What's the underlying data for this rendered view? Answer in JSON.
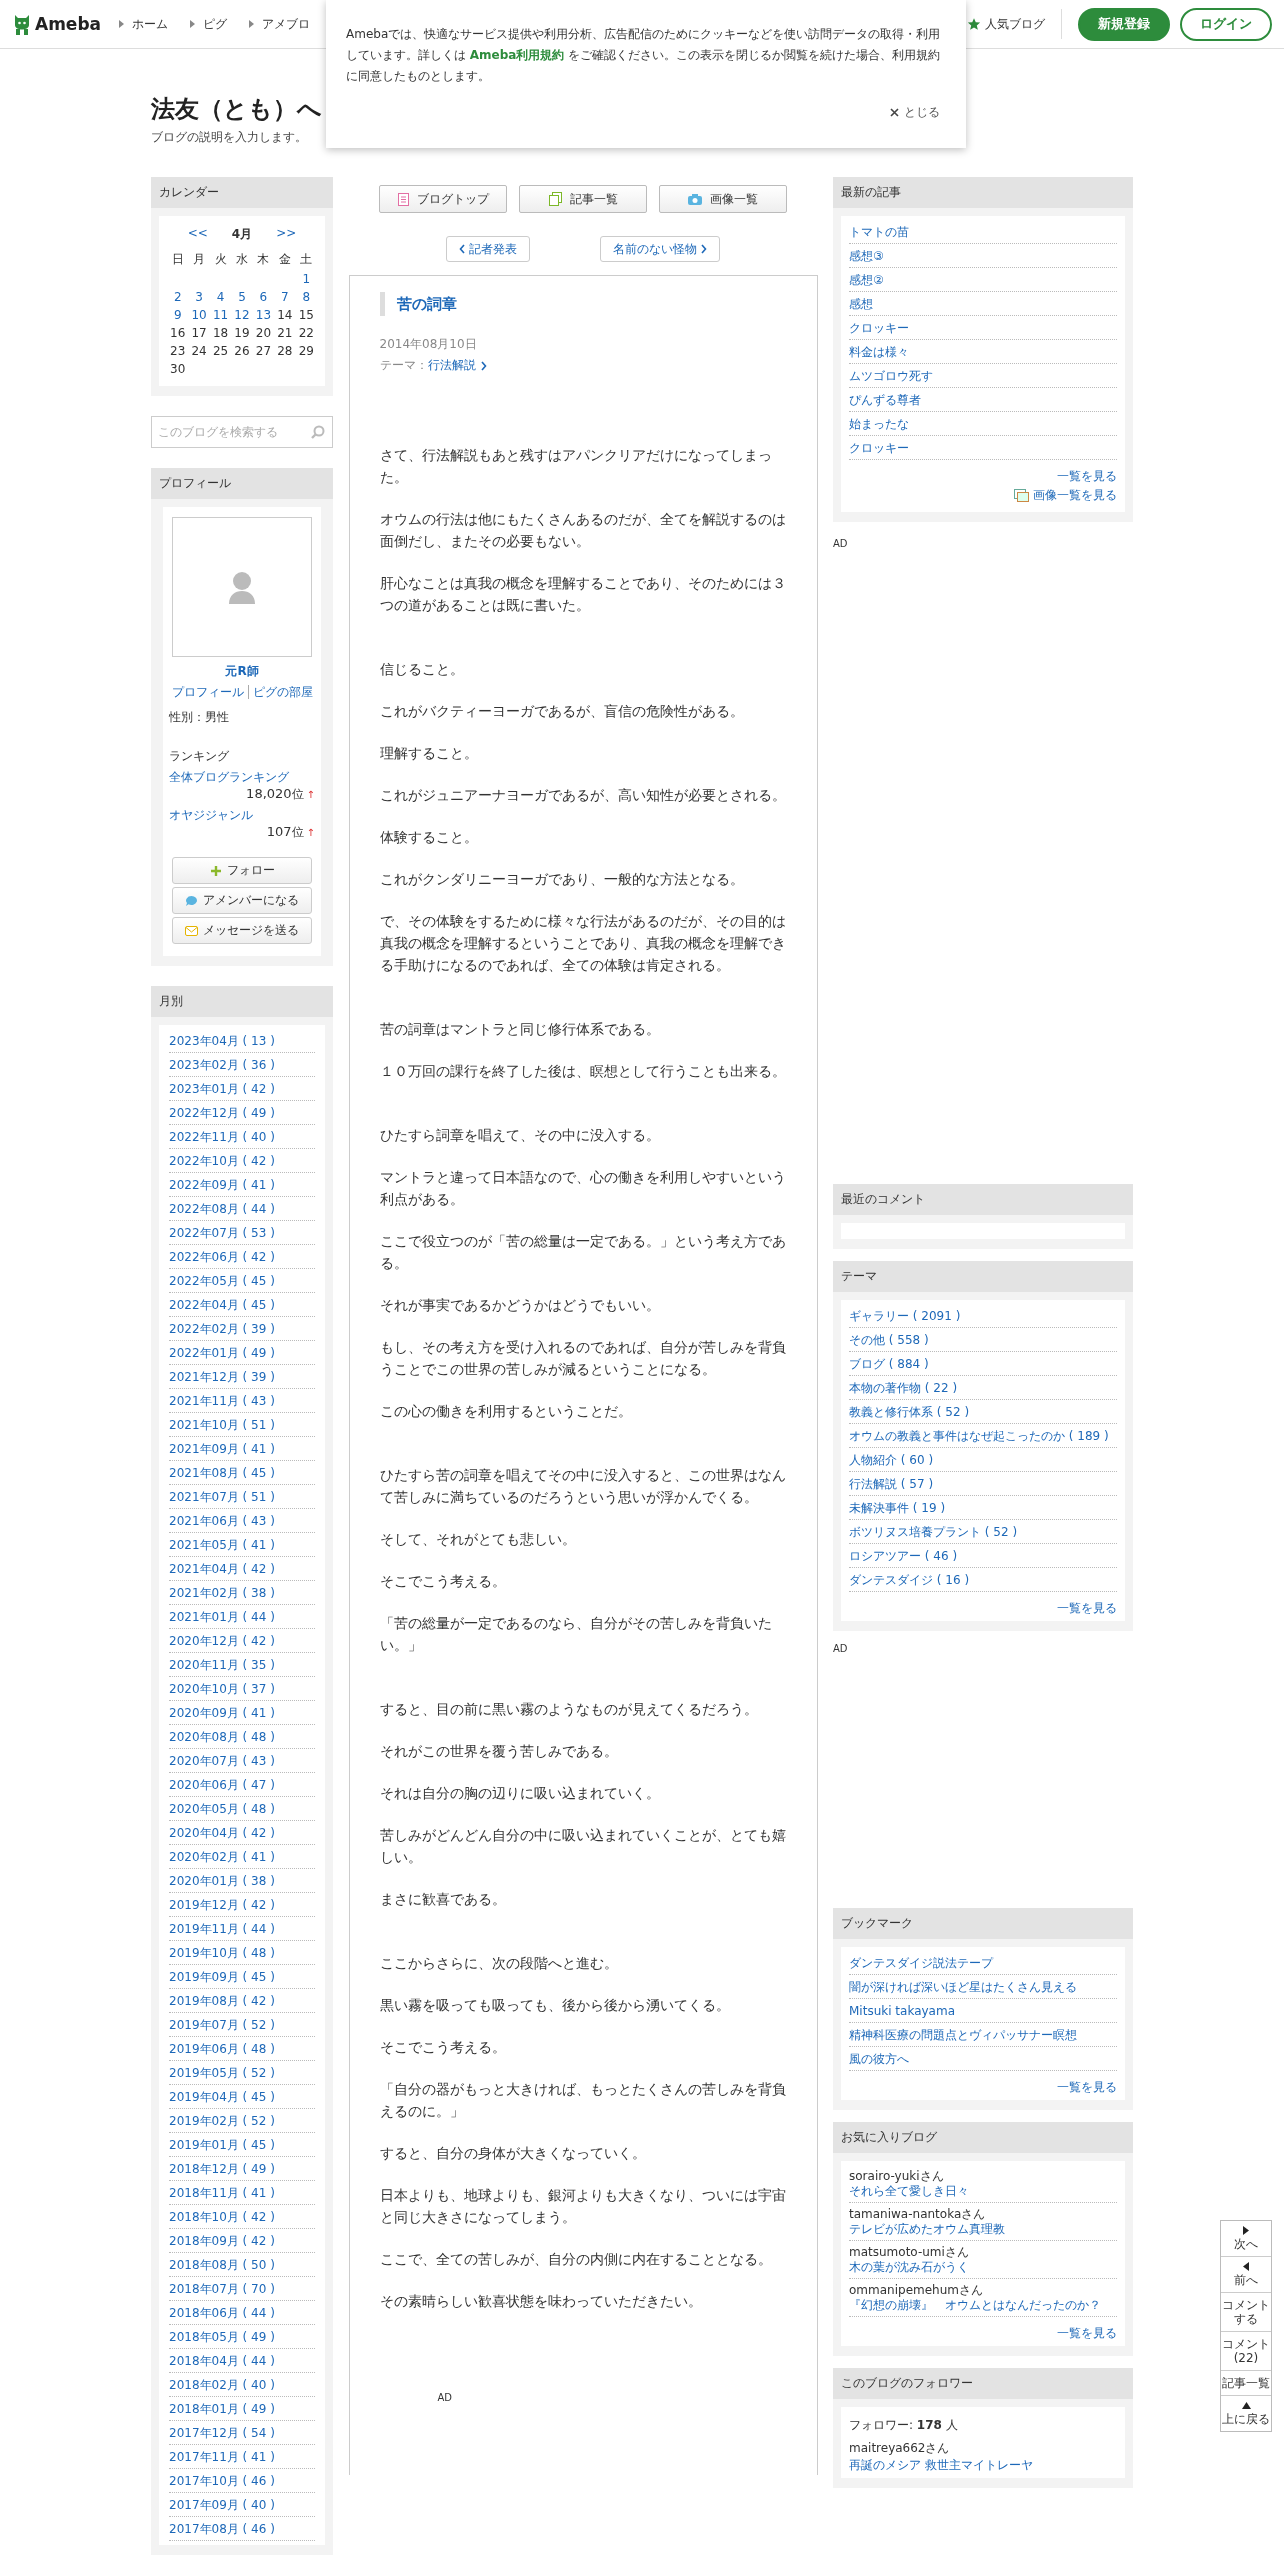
{
  "header": {
    "logo": "Ameba",
    "nav": [
      "ホーム",
      "ピグ",
      "アメブロ"
    ],
    "popular": "人気ブログ",
    "signup": "新規登録",
    "login": "ログイン"
  },
  "cookie_banner": {
    "text": "Amebaでは、快適なサービス提供や利用分析、広告配信のためにクッキーなどを使い訪問データの取得・利用しています。詳しくは",
    "link": "Ameba利用規約",
    "text_after": "をご確認ください。この表示を閉じるか閲覧を続けた場合、利用規約に同意したものとします。",
    "close": "とじる"
  },
  "blog": {
    "title": "法友（とも）へ",
    "description": "ブログの説明を入力します。"
  },
  "calendar": {
    "heading": "カレンダー",
    "prev": "<<",
    "month": "4月",
    "next": ">>",
    "weekdays": [
      "日",
      "月",
      "火",
      "水",
      "木",
      "金",
      "土"
    ],
    "weeks": [
      {
        "days": [
          {
            "day": "1",
            "has_posts": true
          }
        ]
      },
      {
        "days": [
          {
            "day": "2",
            "has_posts": true
          },
          {
            "day": "3",
            "has_posts": true
          },
          {
            "day": "4",
            "has_posts": true
          },
          {
            "day": "5",
            "has_posts": true
          },
          {
            "day": "6",
            "has_posts": true
          },
          {
            "day": "7",
            "has_posts": true
          },
          {
            "day": "8",
            "has_posts": true
          }
        ]
      },
      {
        "days": [
          {
            "day": "9",
            "has_posts": true
          },
          {
            "day": "10",
            "has_posts": true
          },
          {
            "day": "11",
            "has_posts": true
          },
          {
            "day": "12",
            "has_posts": true
          },
          {
            "day": "13",
            "has_posts": true
          },
          {
            "day": "14",
            "has_posts": false
          },
          {
            "day": "15",
            "has_posts": false
          }
        ]
      },
      {
        "days": [
          {
            "day": "16",
            "has_posts": false
          },
          {
            "day": "17",
            "has_posts": false
          },
          {
            "day": "18",
            "has_posts": false
          },
          {
            "day": "19",
            "has_posts": false
          },
          {
            "day": "20",
            "has_posts": false
          },
          {
            "day": "21",
            "has_posts": false
          },
          {
            "day": "22",
            "has_posts": false
          }
        ]
      },
      {
        "days": [
          {
            "day": "23",
            "has_posts": false
          },
          {
            "day": "24",
            "has_posts": false
          },
          {
            "day": "25",
            "has_posts": false
          },
          {
            "day": "26",
            "has_posts": false
          },
          {
            "day": "27",
            "has_posts": false
          },
          {
            "day": "28",
            "has_posts": false
          },
          {
            "day": "29",
            "has_posts": false
          }
        ]
      },
      {
        "days": [
          {
            "day": "30",
            "has_posts": false
          }
        ]
      }
    ]
  },
  "search": {
    "placeholder": "このブログを検索する"
  },
  "profile": {
    "heading": "プロフィール",
    "name": "元R師",
    "links": [
      "プロフィール",
      "ピグの部屋"
    ],
    "gender": "性別：男性",
    "ranking_heading": "ランキング",
    "rankings": [
      {
        "label": "全体ブログランキング",
        "rank": "18,020",
        "unit": "位",
        "arrow": "↑"
      },
      {
        "label": "オヤジジャンル",
        "rank": "107",
        "unit": "位",
        "arrow": "↑"
      }
    ],
    "buttons": [
      {
        "kind": "follow",
        "label": "フォロー"
      },
      {
        "kind": "amember",
        "label": "アメンバーになる"
      },
      {
        "kind": "message",
        "label": "メッセージを送る"
      }
    ]
  },
  "archive": {
    "heading": "月別",
    "months": [
      "2023年04月 ( 13 )",
      "2023年02月 ( 36 )",
      "2023年01月 ( 42 )",
      "2022年12月 ( 49 )",
      "2022年11月 ( 40 )",
      "2022年10月 ( 42 )",
      "2022年09月 ( 41 )",
      "2022年08月 ( 44 )",
      "2022年07月 ( 53 )",
      "2022年06月 ( 42 )",
      "2022年05月 ( 45 )",
      "2022年04月 ( 45 )",
      "2022年02月 ( 39 )",
      "2022年01月 ( 49 )",
      "2021年12月 ( 39 )",
      "2021年11月 ( 43 )",
      "2021年10月 ( 51 )",
      "2021年09月 ( 41 )",
      "2021年08月 ( 45 )",
      "2021年07月 ( 51 )",
      "2021年06月 ( 43 )",
      "2021年05月 ( 41 )",
      "2021年04月 ( 42 )",
      "2021年02月 ( 38 )",
      "2021年01月 ( 44 )",
      "2020年12月 ( 42 )",
      "2020年11月 ( 35 )",
      "2020年10月 ( 37 )",
      "2020年09月 ( 41 )",
      "2020年08月 ( 48 )",
      "2020年07月 ( 43 )",
      "2020年06月 ( 47 )",
      "2020年05月 ( 48 )",
      "2020年04月 ( 42 )",
      "2020年02月 ( 41 )",
      "2020年01月 ( 38 )",
      "2019年12月 ( 42 )",
      "2019年11月 ( 44 )",
      "2019年10月 ( 48 )",
      "2019年09月 ( 45 )",
      "2019年08月 ( 42 )",
      "2019年07月 ( 52 )",
      "2019年06月 ( 48 )",
      "2019年05月 ( 52 )",
      "2019年04月 ( 45 )",
      "2019年02月 ( 52 )",
      "2019年01月 ( 45 )",
      "2018年12月 ( 49 )",
      "2018年11月 ( 41 )",
      "2018年10月 ( 42 )",
      "2018年09月 ( 42 )",
      "2018年08月 ( 50 )",
      "2018年07月 ( 70 )",
      "2018年06月 ( 44 )",
      "2018年05月 ( 49 )",
      "2018年04月 ( 44 )",
      "2018年02月 ( 40 )",
      "2018年01月 ( 49 )",
      "2017年12月 ( 54 )",
      "2017年11月 ( 41 )",
      "2017年10月 ( 46 )",
      "2017年09月 ( 40 )",
      "2017年08月 ( 46 )"
    ]
  },
  "blog_nav": [
    {
      "kind": "top",
      "label": "ブログトップ"
    },
    {
      "kind": "list",
      "label": "記事一覧"
    },
    {
      "kind": "images",
      "label": "画像一覧"
    }
  ],
  "entry_nav": {
    "prev": "記者発表",
    "next": "名前のない怪物"
  },
  "article": {
    "title": "苦の詞章",
    "date": "2014年08月10日",
    "theme_label": "テーマ：",
    "theme": "行法解説",
    "sections": [
      [
        "さて、行法解説もあと残すはアパンクリアだけになってしまった。",
        "オウムの行法は他にもたくさんあるのだが、全てを解説するのは面倒だし、またその必要もない。",
        "肝心なことは真我の概念を理解することであり、そのためには３つの道があることは既に書いた。"
      ],
      [
        "信じること。",
        "これがバクティーヨーガであるが、盲信の危険性がある。",
        "理解すること。",
        "これがジュニアーナヨーガであるが、高い知性が必要とされる。",
        "体験すること。",
        "これがクンダリニーヨーガであり、一般的な方法となる。",
        "で、その体験をするために様々な行法があるのだが、その目的は真我の概念を理解するということであり、真我の概念を理解できる手助けになるのであれば、全ての体験は肯定される。"
      ],
      [
        "苦の詞章はマントラと同じ修行体系である。",
        "１０万回の課行を終了した後は、瞑想として行うことも出来る。"
      ],
      [
        "ひたすら詞章を唱えて、その中に没入する。",
        "マントラと違って日本語なので、心の働きを利用しやすいという利点がある。",
        "ここで役立つのが「苦の総量は一定である。」という考え方である。",
        "それが事実であるかどうかはどうでもいい。",
        "もし、その考え方を受け入れるのであれば、自分が苦しみを背負うことでこの世界の苦しみが減るということになる。",
        "この心の働きを利用するということだ。"
      ],
      [
        "ひたすら苦の詞章を唱えてその中に没入すると、この世界はなんて苦しみに満ちているのだろうという思いが浮かんでくる。",
        "そして、それがとても悲しい。",
        "そこでこう考える。",
        "「苦の総量が一定であるのなら、自分がその苦しみを背負いたい。」"
      ],
      [
        "すると、目の前に黒い霧のようなものが見えてくるだろう。",
        "それがこの世界を覆う苦しみである。",
        "それは自分の胸の辺りに吸い込まれていく。",
        "苦しみがどんどん自分の中に吸い込まれていくことが、とても嬉しい。",
        "まさに歓喜である。"
      ],
      [
        "ここからさらに、次の段階へと進む。",
        "黒い霧を吸っても吸っても、後から後から湧いてくる。",
        "そこでこう考える。",
        "「自分の器がもっと大きければ、もっとたくさんの苦しみを背負えるのに。」",
        "すると、自分の身体が大きくなっていく。",
        "日本よりも、地球よりも、銀河よりも大きくなり、ついには宇宙と同じ大きさになってしまう。",
        "ここで、全ての苦しみが、自分の内側に内在することとなる。",
        "その素晴らしい歓喜状態を味わっていただきたい。"
      ]
    ],
    "ad": "AD"
  },
  "recent_entries": {
    "heading": "最新の記事",
    "items": [
      "トマトの苗",
      "感想③",
      "感想②",
      "感想",
      "クロッキー",
      "料金は様々",
      "ムツゴロウ死す",
      "ぴんずる尊者",
      "始まったな",
      "クロッキー"
    ],
    "more": "一覧を見る",
    "images": "画像一覧を見る"
  },
  "ad_1": "AD",
  "recent_comments": {
    "heading": "最近のコメント"
  },
  "themes": {
    "heading": "テーマ",
    "items": [
      "ギャラリー ( 2091 )",
      "その他 ( 558 )",
      "ブログ ( 884 )",
      "本物の著作物 ( 22 )",
      "教義と修行体系 ( 52 )",
      "オウムの教義と事件はなぜ起こったのか ( 189 )",
      "人物紹介 ( 60 )",
      "行法解説 ( 57 )",
      "未解決事件 ( 19 )",
      "ボツリヌス培養プラント ( 52 )",
      "ロシアツアー ( 46 )",
      "ダンテスダイジ ( 16 )"
    ],
    "more": "一覧を見る"
  },
  "ad_2": "AD",
  "bookmarks": {
    "heading": "ブックマーク",
    "items": [
      "ダンテスダイジ説法テープ",
      "闇が深ければ深いほど星はたくさん見える",
      "Mitsuki takayama",
      "精神科医療の問題点とヴィパッサナー瞑想",
      "風の彼方へ"
    ],
    "more": "一覧を見る"
  },
  "favorite_blogs": {
    "heading": "お気に入りブログ",
    "items": [
      {
        "user": "sorairo-yukiさん",
        "title": "それら全て愛しき日々"
      },
      {
        "user": "tamaniwa-nantokaさん",
        "title": "テレビが広めたオウム真理教"
      },
      {
        "user": "matsumoto-umiさん",
        "title": "木の葉が沈み石がうく"
      },
      {
        "user": "ommanipemehumさん",
        "title": "『幻想の崩壊』　オウムとはなんだったのか？"
      }
    ],
    "more": "一覧を見る"
  },
  "followers": {
    "heading": "このブログのフォロワー",
    "count": "フォロワー: **178** 人",
    "items": [
      {
        "user": "maitreya662さん",
        "title": "再誕のメシア 救世主マイトレーヤ"
      }
    ]
  },
  "side_nav": [
    {
      "kind": "next",
      "label": "次へ"
    },
    {
      "kind": "prev",
      "label": "前へ"
    },
    {
      "kind": "plain",
      "label": "コメントする"
    },
    {
      "kind": "plain",
      "label": "コメント(22)"
    },
    {
      "kind": "plain",
      "label": "記事一覧"
    },
    {
      "kind": "top",
      "label": "上に戻る"
    }
  ]
}
